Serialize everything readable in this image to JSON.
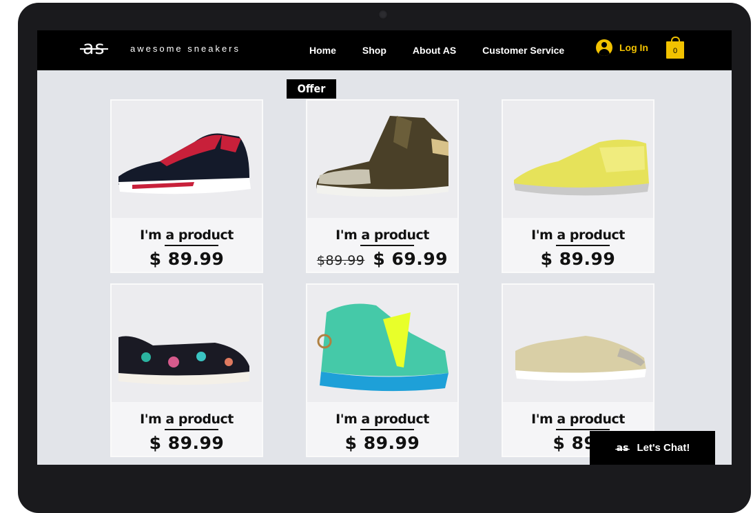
{
  "header": {
    "logo_mark": "as",
    "logo_text": "awesome sneakers",
    "nav": [
      "Home",
      "Shop",
      "About AS",
      "Customer Service"
    ],
    "login_label": "Log In",
    "cart_count": "0"
  },
  "offer_badge": "Offer",
  "products": [
    {
      "name": "I'm a product",
      "price": "$ 89.99",
      "old_price": "",
      "image": "black-red-sneaker"
    },
    {
      "name": "I'm a product",
      "price": "$ 69.99",
      "old_price": "$89.99",
      "image": "brown-hightop-sneaker"
    },
    {
      "name": "I'm a product",
      "price": "$ 89.99",
      "old_price": "",
      "image": "yellow-running-sneaker"
    },
    {
      "name": "I'm a product",
      "price": "$ 89.99",
      "old_price": "",
      "image": "floral-sneaker"
    },
    {
      "name": "I'm a product",
      "price": "$ 89.99",
      "old_price": "",
      "image": "teal-hightop-sneaker"
    },
    {
      "name": "I'm a product",
      "price": "$ 89.",
      "old_price": "",
      "image": "gold-glitter-sneaker"
    }
  ],
  "chat": {
    "logo": "as",
    "label": "Let's Chat!"
  },
  "colors": {
    "accent": "#f2c200",
    "header_bg": "#000000",
    "page_bg": "#e2e4e9"
  }
}
